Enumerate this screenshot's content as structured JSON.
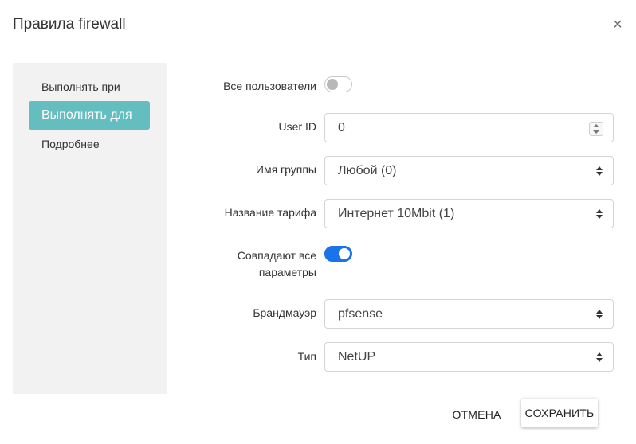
{
  "dialog": {
    "title": "Правила firewall",
    "close_glyph": "×"
  },
  "sidebar": {
    "items": [
      {
        "label": "Выполнять при",
        "active": false
      },
      {
        "label": "Выполнять для",
        "active": true
      },
      {
        "label": "Подробнее",
        "active": false
      }
    ]
  },
  "form": {
    "all_users": {
      "label": "Все пользователи",
      "checked": false
    },
    "user_id": {
      "label": "User ID",
      "value": "0"
    },
    "group_name": {
      "label": "Имя группы",
      "value": "Любой (0)"
    },
    "tariff_name": {
      "label": "Название тарифа",
      "value": "Интернет 10Mbit (1)"
    },
    "match_all": {
      "label_line1": "Совпадают все",
      "label_line2": "параметры",
      "checked": true
    },
    "firewall": {
      "label": "Брандмауэр",
      "value": "pfsense"
    },
    "type": {
      "label": "Тип",
      "value": "NetUP"
    }
  },
  "footer": {
    "cancel_label": "ОТМЕНА",
    "save_label": "СОХРАНИТЬ"
  },
  "colors": {
    "accent_teal": "#64bdbf",
    "toggle_on": "#1a73e8"
  }
}
